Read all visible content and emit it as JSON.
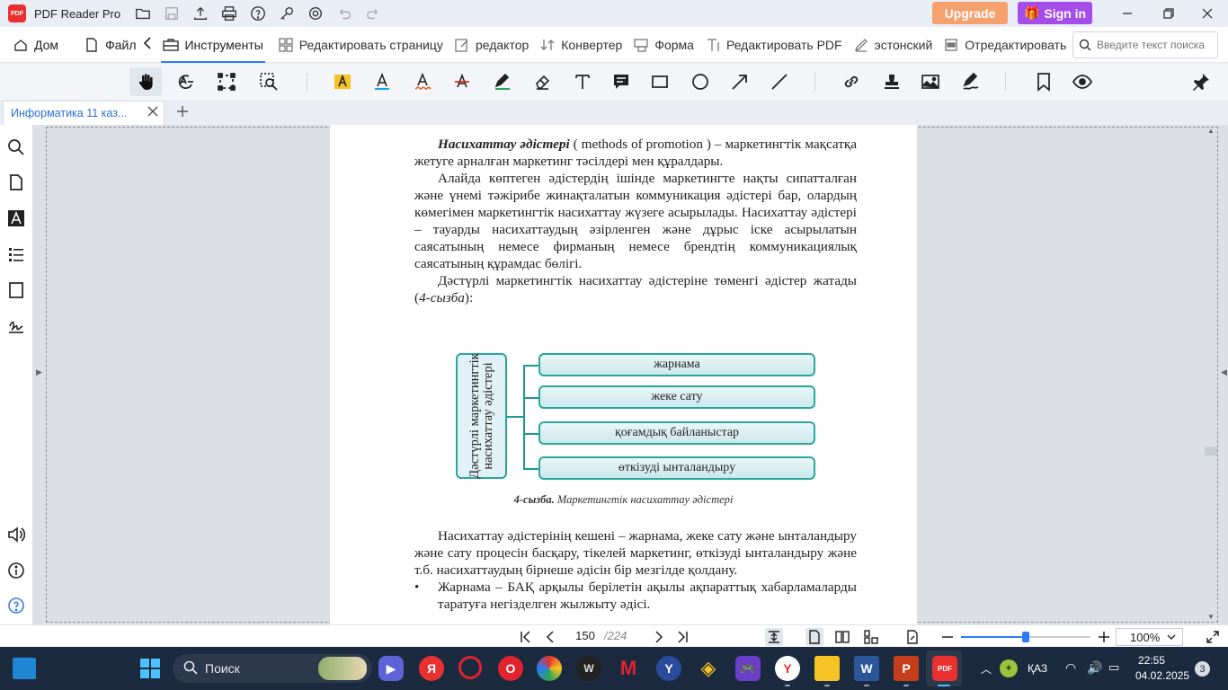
{
  "titlebar": {
    "app_logo_text": "PDF",
    "app_title": "PDF Reader Pro",
    "upgrade_label": "Upgrade",
    "signin_label": "Sign in"
  },
  "menubar": {
    "items": [
      {
        "label": "Дом",
        "icon": "home-icon"
      },
      {
        "label": "Файл",
        "icon": "file-icon"
      },
      {
        "label": "Инструменты",
        "icon": "toolbox-icon",
        "active": true
      },
      {
        "label": "Редактировать страницу",
        "icon": "grid-icon"
      },
      {
        "label": "редактор",
        "icon": "edit-icon"
      },
      {
        "label": "Конвертер",
        "icon": "convert-icon"
      },
      {
        "label": "Форма",
        "icon": "form-icon"
      },
      {
        "label": "Редактировать PDF",
        "icon": "text-edit-icon"
      },
      {
        "label": "эстонский",
        "icon": "sign-icon"
      },
      {
        "label": "Отредактировать",
        "icon": "redact-icon"
      }
    ],
    "search_placeholder": "Введите текст поиска"
  },
  "tab": {
    "title": "Информатика 11 каз..."
  },
  "document": {
    "p1_head": "Насихаттау әдістері",
    "p1_tail": " ( methods of promotion ) – маркетингтік мақсатқа жетуге арналған маркетинг тәсілдері мен құралдары.",
    "p2": "Алайда көптеген әдістердің ішінде маркетингте нақты сипатталған және үнемі тәжірибе жинақталатын коммуникация әдістері бар, олардың көмегімен маркетингтік насихаттау жүзеге асырылады. Насихаттау әдістері – тауарды насихаттаудың әзірленген және дұрыс іске асырылатын саясатының немесе фирманың немесе брендтің коммуникациялық саясатының құрамдас бөлігі.",
    "p3_a": "Дәстүрлі маркетингтік насихаттау әдістеріне төменгі әдістер жатады (",
    "p3_ref": "4-сызба",
    "p3_b": "):",
    "diagram_main": "Дәстүрлі маркетингтік насихаттау әдістері",
    "diagram_items": [
      "жарнама",
      "жеке сату",
      "қоғамдық байланыстар",
      "өткізуді ынталандыру"
    ],
    "caption_bold": "4-сызба.",
    "caption_text": " Маркетингтік насихаттау әдістері",
    "p4_head": "Насихаттау әдістерінің кешені",
    "p4_tail": " – жарнама, жеке сату және ынталандыру және сату процесін басқару, тікелей маркетинг, өткізуді ынталандыру және т.б. насихаттаудың бірнеше әдісін бір мезгілде қолдану.",
    "bullet_head": "Жарнама",
    "bullet_tail": " – БАҚ арқылы берілетін ақылы ақпараттық хабарламаларды таратуға негізделген жылжыту әдісі."
  },
  "statusbar": {
    "current_page": "150",
    "total_pages": "/224",
    "zoom": "100%",
    "zoom_fraction": 0.5
  },
  "taskbar": {
    "search_label": "Поиск",
    "lang": "ҚАЗ",
    "time": "22:55",
    "date": "04.02.2025",
    "notifications": "3"
  },
  "colors": {
    "accent": "#2a7ef5",
    "upgrade": "#f5a16d",
    "signin": "#a44de9",
    "diagram_border": "#2aa79c",
    "taskbar_bg": "#1c2a3f"
  }
}
